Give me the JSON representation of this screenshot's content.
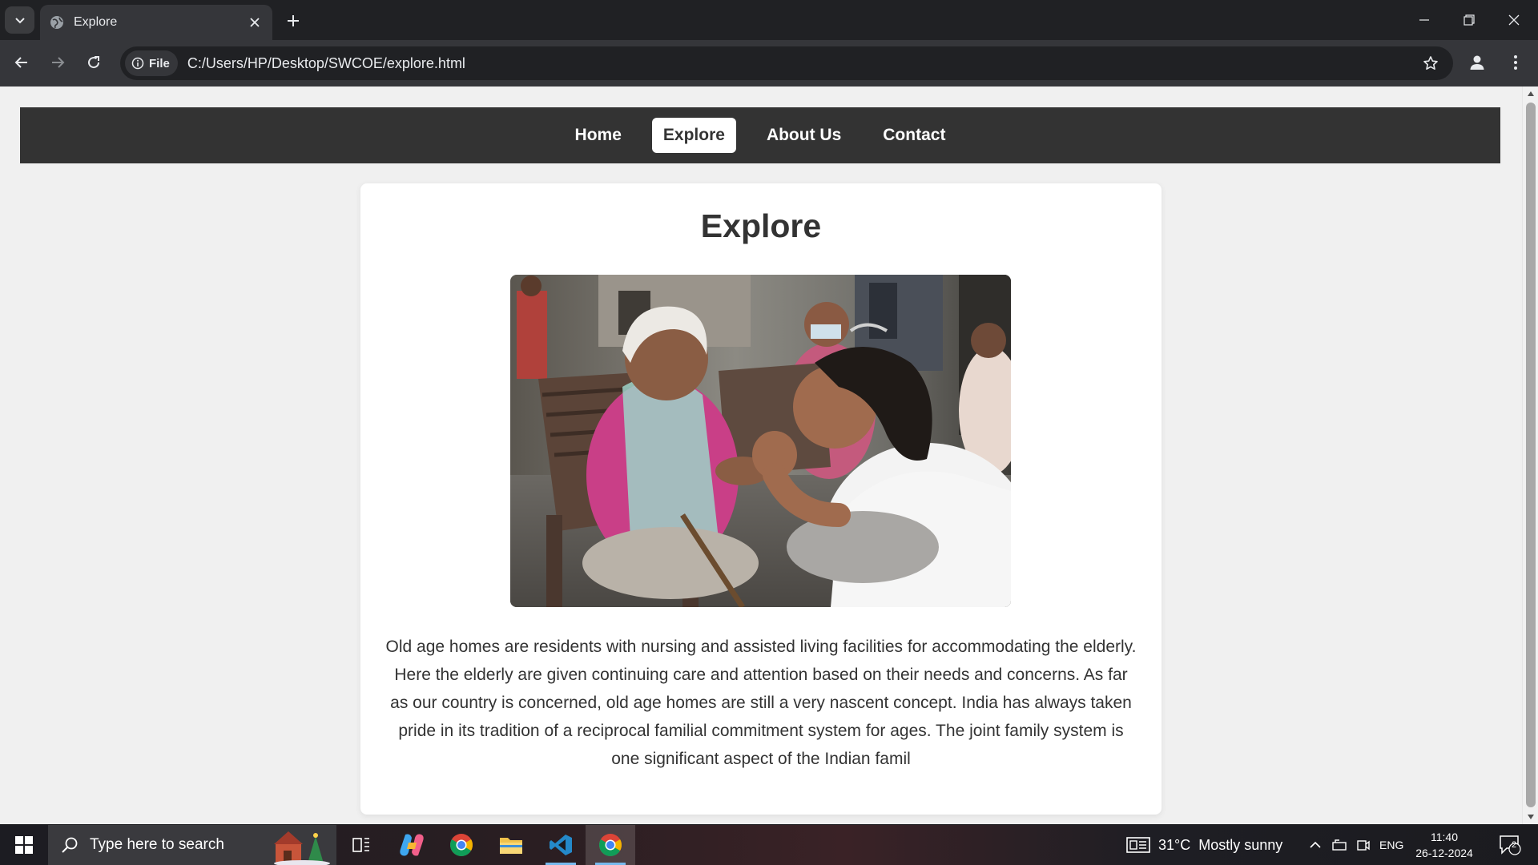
{
  "browser": {
    "tab": {
      "title": "Explore",
      "favicon": "globe-icon"
    },
    "address": {
      "chip_label": "File",
      "url": "C:/Users/HP/Desktop/SWCOE/explore.html"
    }
  },
  "page": {
    "nav": {
      "items": [
        {
          "label": "Home",
          "active": false
        },
        {
          "label": "Explore",
          "active": true
        },
        {
          "label": "About Us",
          "active": false
        },
        {
          "label": "Contact",
          "active": false
        }
      ]
    },
    "heading": "Explore",
    "image": {
      "subject": "volunteer holding hands with an elderly woman in a pink top, seated on plastic chairs"
    },
    "paragraph": "Old age homes are residents with nursing and assisted living facilities for accommodating the elderly. Here the elderly are given continuing care and attention based on their needs and concerns. As far as our country is concerned, old age homes are still a very nascent concept. India has always taken pride in its tradition of a reciprocal familial commitment system for ages. The joint family system is one significant aspect of the Indian famil"
  },
  "taskbar": {
    "search_placeholder": "Type here to search",
    "weather": {
      "temp": "31°C",
      "condition": "Mostly sunny"
    },
    "language": "ENG",
    "time": "11:40",
    "date": "26-12-2024",
    "notification_count": "2"
  },
  "colors": {
    "navbar": "#333333",
    "page_bg": "#f0f0f0",
    "card_bg": "#ffffff",
    "chrome_dark": "#202124",
    "chrome_toolbar": "#35363a"
  }
}
